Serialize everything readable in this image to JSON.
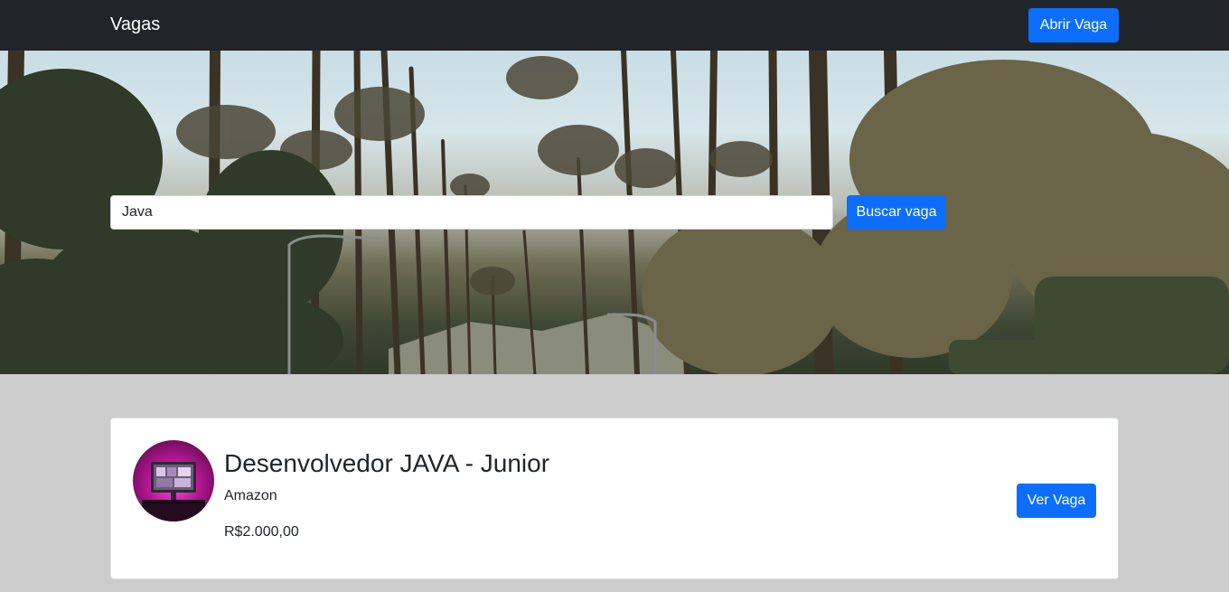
{
  "navbar": {
    "brand": "Vagas",
    "open_job_label": "Abrir Vaga"
  },
  "search": {
    "value": "Java",
    "button_label": "Buscar vaga"
  },
  "job": {
    "title": "Desenvolvedor JAVA - Junior",
    "company": "Amazon",
    "salary": "R$2.000,00",
    "button_label": "Ver Vaga"
  },
  "colors": {
    "navbar": "#212529",
    "primary": "#0d6efd",
    "page_background": "#cccccc",
    "card_background": "#ffffff"
  }
}
